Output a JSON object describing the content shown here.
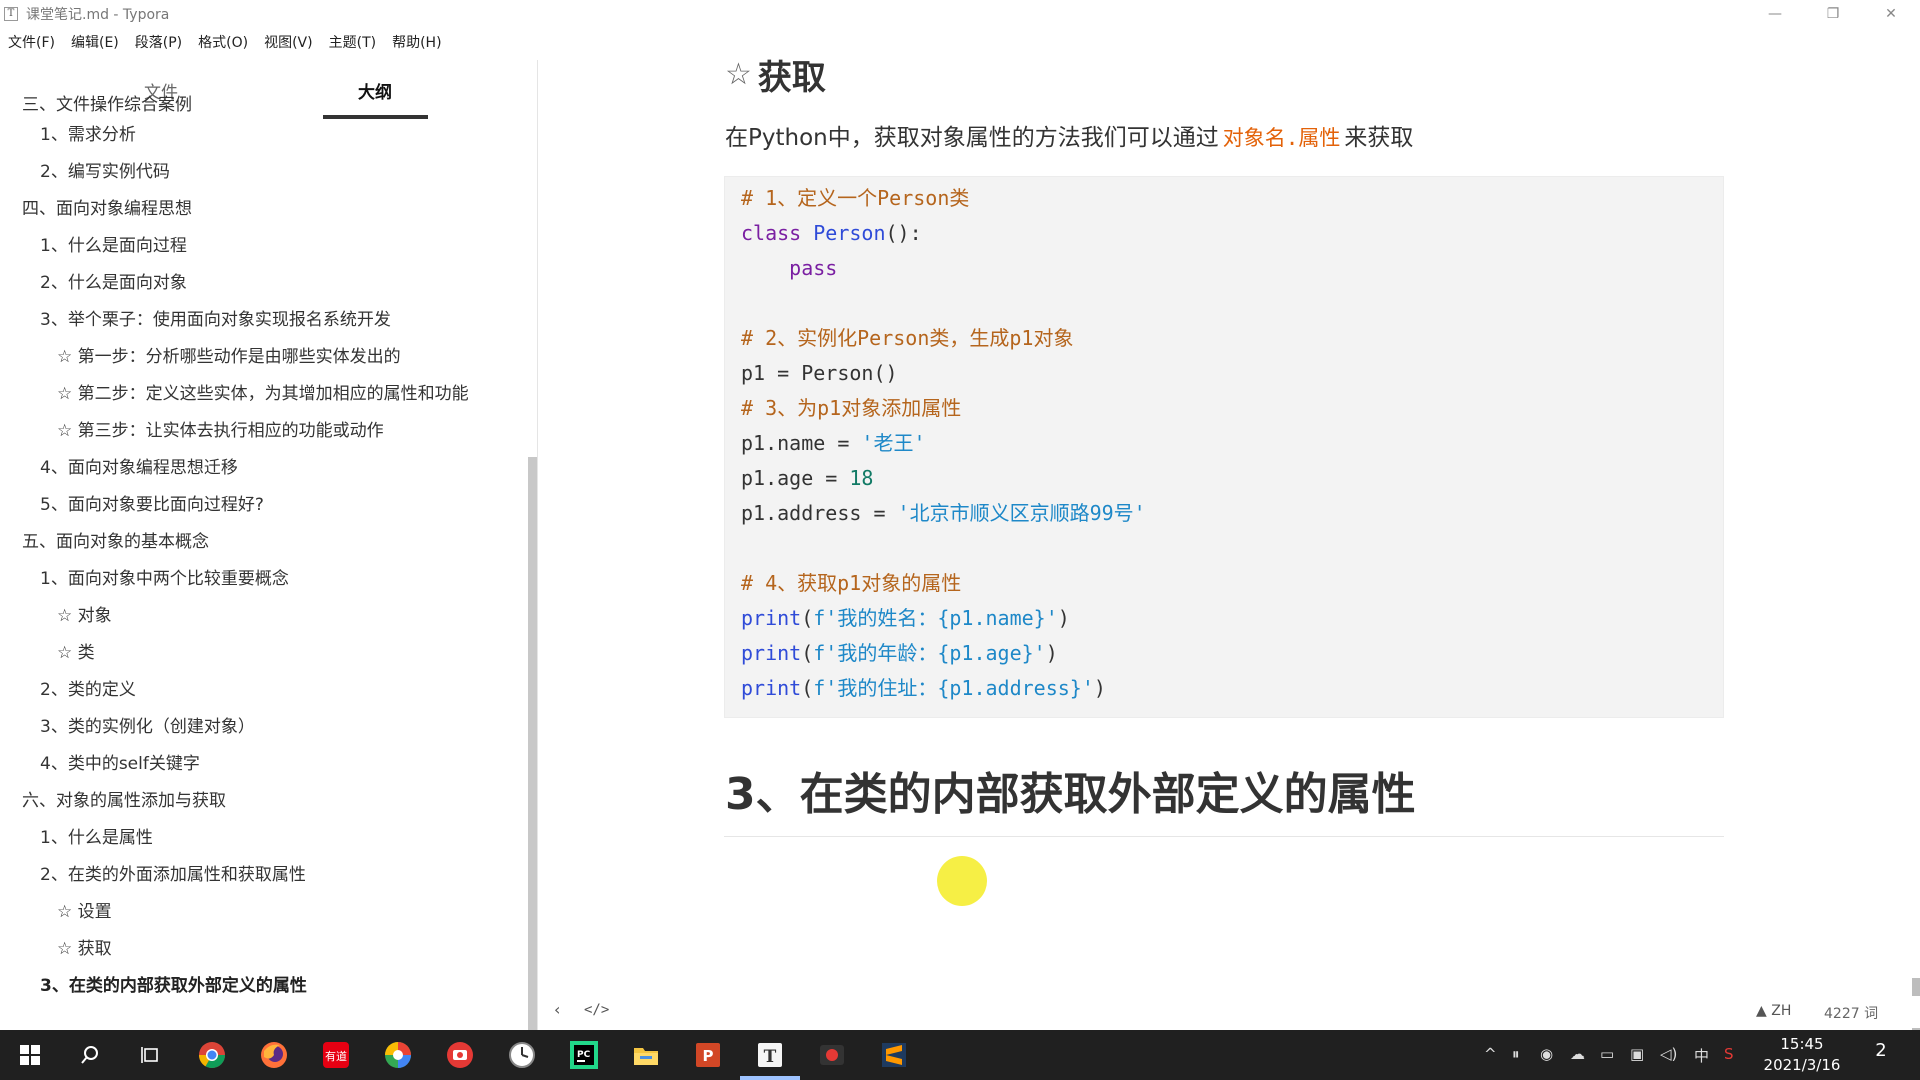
{
  "window": {
    "title": "课堂笔记.md - Typora",
    "app_icon": "T",
    "minimize": "—",
    "restore": "❐",
    "close": "✕"
  },
  "menu": [
    "文件(F)",
    "编辑(E)",
    "段落(P)",
    "格式(O)",
    "视图(V)",
    "主题(T)",
    "帮助(H)"
  ],
  "sidebar": {
    "tabs": [
      "文件",
      "大纲"
    ],
    "outline": [
      {
        "text": "三、文件操作综合案例",
        "level": 1
      },
      {
        "text": "1、需求分析",
        "level": 2
      },
      {
        "text": "2、编写实例代码",
        "level": 2
      },
      {
        "text": "四、面向对象编程思想",
        "level": 1
      },
      {
        "text": "1、什么是面向过程",
        "level": 2
      },
      {
        "text": "2、什么是面向对象",
        "level": 2
      },
      {
        "text": "3、举个栗子：使用面向对象实现报名系统开发",
        "level": 2
      },
      {
        "text": "☆ 第一步：分析哪些动作是由哪些实体发出的",
        "level": 3
      },
      {
        "text": "☆ 第二步：定义这些实体，为其增加相应的属性和功能",
        "level": 3
      },
      {
        "text": "☆ 第三步：让实体去执行相应的功能或动作",
        "level": 3
      },
      {
        "text": "4、面向对象编程思想迁移",
        "level": 2
      },
      {
        "text": "5、面向对象要比面向过程好?",
        "level": 2
      },
      {
        "text": "五、面向对象的基本概念",
        "level": 1
      },
      {
        "text": "1、面向对象中两个比较重要概念",
        "level": 2
      },
      {
        "text": "☆ 对象",
        "level": 3
      },
      {
        "text": "☆ 类",
        "level": 3
      },
      {
        "text": "2、类的定义",
        "level": 2
      },
      {
        "text": "3、类的实例化（创建对象）",
        "level": 2
      },
      {
        "text": "4、类中的self关键字",
        "level": 2
      },
      {
        "text": "六、对象的属性添加与获取",
        "level": 1
      },
      {
        "text": "1、什么是属性",
        "level": 2
      },
      {
        "text": "2、在类的外面添加属性和获取属性",
        "level": 2
      },
      {
        "text": "☆ 设置",
        "level": 3
      },
      {
        "text": "☆ 获取",
        "level": 3
      },
      {
        "text": "3、在类的内部获取外部定义的属性",
        "level": 2,
        "active": true
      }
    ]
  },
  "document": {
    "heading_star": "☆",
    "heading": "获取",
    "para_before": "在Python中，获取对象属性的方法我们可以通过",
    "para_code": "对象名.属性",
    "para_after": "来获取",
    "code": {
      "l1": "# 1、定义一个Person类",
      "l2_kw": "class",
      "l2_name": "Person",
      "l2_rest": "():",
      "l3": "    pass",
      "l5": "# 2、实例化Person类，生成p1对象",
      "l6": "p1 = Person()",
      "l7": "# 3、为p1对象添加属性",
      "l8_a": "p1.name = ",
      "l8_s": "'老王'",
      "l9_a": "p1.age = ",
      "l9_n": "18",
      "l10_a": "p1.address = ",
      "l10_s": "'北京市顺义区京顺路99号'",
      "l12": "# 4、获取p1对象的属性",
      "l13_f": "print",
      "l13_s": "f'我的姓名：{p1.name}'",
      "l14_f": "print",
      "l14_s": "f'我的年龄：{p1.age}'",
      "l15_f": "print",
      "l15_s": "f'我的住址：{p1.address}'"
    },
    "section_heading": "3、在类的内部获取外部定义的属性"
  },
  "statusbar": {
    "back": "‹",
    "source": "</>",
    "lang": "ZH",
    "warn": "▲",
    "words": "4227 词"
  },
  "taskbar": {
    "clock_time": "15:45",
    "clock_date": "2021/3/16",
    "ime": "中",
    "notifications": "2"
  }
}
